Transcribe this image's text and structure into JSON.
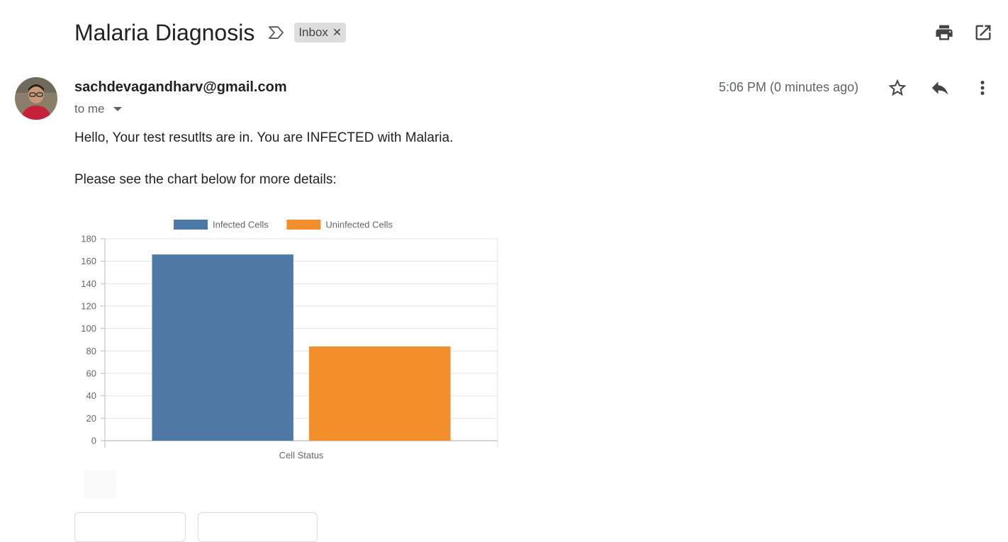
{
  "email": {
    "subject": "Malaria Diagnosis",
    "label": "Inbox",
    "sender": "sachdevagandharv@gmail.com",
    "recipient_text": "to me",
    "timestamp": "5:06 PM (0 minutes ago)",
    "body_lines": [
      "Hello, Your test resutlts are in. You are INFECTED with Malaria.",
      "Please see the chart below for more details:"
    ]
  },
  "icons": {
    "importance": "importance-marker-icon",
    "label_remove": "close-icon",
    "print": "print-icon",
    "open_new_window": "open-in-new-icon",
    "star": "star-icon",
    "reply": "reply-icon",
    "more": "more-vert-icon"
  },
  "chart_data": {
    "type": "bar",
    "xlabel": "Cell Status",
    "ylabel": "",
    "ylim": [
      0,
      180
    ],
    "yticks": [
      0,
      20,
      40,
      60,
      80,
      100,
      120,
      140,
      160,
      180
    ],
    "categories": [
      ""
    ],
    "series": [
      {
        "name": "Infected Cells",
        "values": [
          166
        ],
        "color": "#4e79a7"
      },
      {
        "name": "Uninfected Cells",
        "values": [
          84
        ],
        "color": "#f28e2b"
      }
    ],
    "grid": true,
    "legend": "top-center"
  }
}
